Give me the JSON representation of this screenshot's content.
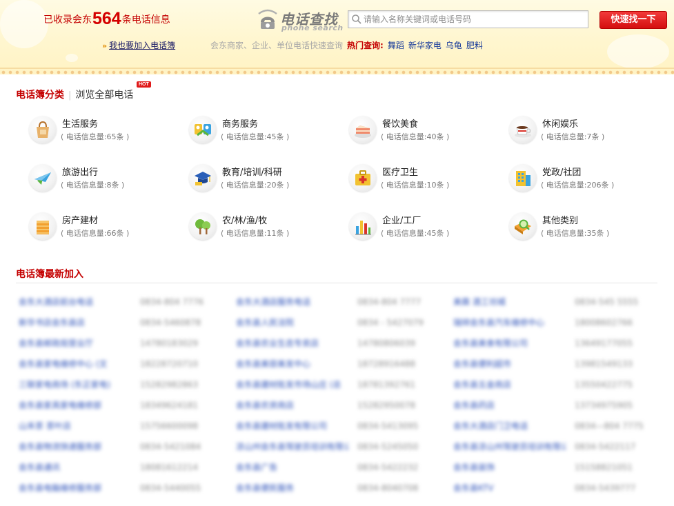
{
  "header": {
    "count_prefix": "已收录会东",
    "count_number": "564",
    "count_suffix": "条电话信息",
    "join_link": "我也要加入电话簿",
    "logo_title": "电话查找",
    "logo_subtitle": "phone search",
    "search_placeholder": "请输入名称关键词或电话号码",
    "search_button": "快速找一下",
    "description": "会东商家、企业、单位电话快速查询",
    "hot_label": "热门查询:",
    "hot_links": [
      "舞蹈",
      "新华家电",
      "乌龟",
      "肥料"
    ]
  },
  "categories_section": {
    "title": "电话簿分类",
    "browse_all": "浏览全部电话",
    "hot_badge": "HOT"
  },
  "categories": [
    {
      "name": "生活服务",
      "info": "( 电话信息量:65条 )",
      "icon": "shopping-bag-icon"
    },
    {
      "name": "商务服务",
      "info": "( 电话信息量:45条 )",
      "icon": "handshake-icon"
    },
    {
      "name": "餐饮美食",
      "info": "( 电话信息量:40条 )",
      "icon": "cake-icon"
    },
    {
      "name": "休闲娱乐",
      "info": "( 电话信息量:7条 )",
      "icon": "coffee-cup-icon"
    },
    {
      "name": "旅游出行",
      "info": "( 电话信息量:8条 )",
      "icon": "airplane-icon"
    },
    {
      "name": "教育/培训/科研",
      "info": "( 电话信息量:20条 )",
      "icon": "graduation-cap-icon"
    },
    {
      "name": "医疗卫生",
      "info": "( 电话信息量:10条 )",
      "icon": "medical-kit-icon"
    },
    {
      "name": "党政/社团",
      "info": "( 电话信息量:206条 )",
      "icon": "building-icon"
    },
    {
      "name": "房产建材",
      "info": "( 电话信息量:66条 )",
      "icon": "house-icon"
    },
    {
      "name": "农/林/渔/牧",
      "info": "( 电话信息量:11条 )",
      "icon": "tree-icon"
    },
    {
      "name": "企业/工厂",
      "info": "( 电话信息量:45条 )",
      "icon": "factory-chart-icon"
    },
    {
      "name": "其他类别",
      "info": "( 电话信息量:35条 )",
      "icon": "magnifier-box-icon"
    }
  ],
  "latest": {
    "title": "电话簿最新加入",
    "rows": [
      [
        {
          "name": "会东大酒店前台电话",
          "phone": "0834-804 7776"
        },
        {
          "name": "会东大酒店服务电话",
          "phone": "0834-804 7777"
        },
        {
          "name": "美霖 酒工坊城",
          "phone": "0834-545 5555"
        }
      ],
      [
        {
          "name": "新华书店会东县店",
          "phone": "0834-5460878"
        },
        {
          "name": "会东县人民法院",
          "phone": "0834 - 5427079"
        },
        {
          "name": "瑞祥会东县汽车维修中心",
          "phone": "18008602766"
        }
      ],
      [
        {
          "name": "会东县邮政局营业厅",
          "phone": "14780183029"
        },
        {
          "name": "会东县农业生态专卖店",
          "phone": "14780806039"
        },
        {
          "name": "会东县美食有限公司",
          "phone": "13649177055"
        }
      ],
      [
        {
          "name": "会东县家电维修中心 (文",
          "phone": "18228720710"
        },
        {
          "name": "会东县美容美发中心",
          "phone": "18728916488"
        },
        {
          "name": "会东县便利超市",
          "phone": "13981549133"
        }
      ],
      [
        {
          "name": "三联家电商场 (东正家电)",
          "phone": "15282982863"
        },
        {
          "name": "会东县建材批发市场山庄 (总",
          "phone": "18781392761"
        },
        {
          "name": "会东县五金商店",
          "phone": "13550422775"
        }
      ],
      [
        {
          "name": "会东县家具家电维修部",
          "phone": "18349624181"
        },
        {
          "name": "会东县农资商店",
          "phone": "15282950078"
        },
        {
          "name": "会东县药店",
          "phone": "13734975905"
        }
      ],
      [
        {
          "name": "山禾茶 茶叶店",
          "phone": "15756600098"
        },
        {
          "name": "会东县建材批发有限公司",
          "phone": "0834-5413095"
        },
        {
          "name": "会东大酒店门卫电话",
          "phone": "0834—804 7775"
        }
      ],
      [
        {
          "name": "会东县物流快递服务部",
          "phone": "0834-5421084"
        },
        {
          "name": "凉山州会东县驾驶员培训有限公司",
          "phone": "0834-5245050"
        },
        {
          "name": "会东县凉山州驾驶员培训有限公司",
          "phone": "0834-5422117"
        }
      ],
      [
        {
          "name": "会东县通讯",
          "phone": "18081612214"
        },
        {
          "name": "会东县广告",
          "phone": "0834-5422232"
        },
        {
          "name": "会东县装饰",
          "phone": "15158821051"
        }
      ],
      [
        {
          "name": "会东县电脑维修服务部",
          "phone": "0834-5440055"
        },
        {
          "name": "会东县便民服务",
          "phone": "0834-8040708"
        },
        {
          "name": "会东县KTV",
          "phone": "0834-5439777"
        }
      ]
    ]
  }
}
